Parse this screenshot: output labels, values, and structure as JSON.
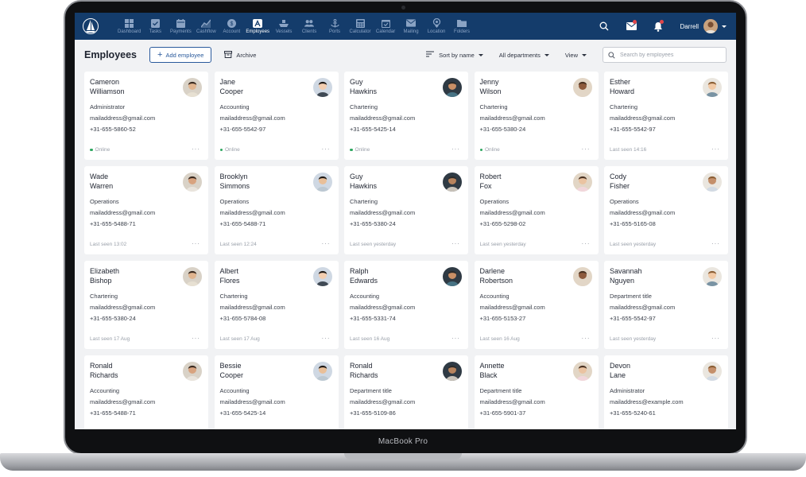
{
  "device_label": "MacBook Pro",
  "nav": {
    "items": [
      {
        "label": "Dashboard",
        "icon": "dashboard-icon"
      },
      {
        "label": "Tasks",
        "icon": "tasks-icon"
      },
      {
        "label": "Payments",
        "icon": "payments-icon"
      },
      {
        "label": "Cashflow",
        "icon": "cashflow-icon"
      },
      {
        "label": "Account",
        "icon": "account-icon"
      },
      {
        "label": "Employees",
        "icon": "employees-icon",
        "active": true
      },
      {
        "label": "Vessels",
        "icon": "vessels-icon"
      },
      {
        "label": "Clients",
        "icon": "clients-icon"
      },
      {
        "label": "Ports",
        "icon": "ports-icon"
      },
      {
        "label": "Calculator",
        "icon": "calculator-icon"
      },
      {
        "label": "Calendar",
        "icon": "calendar-icon"
      },
      {
        "label": "Mailing",
        "icon": "mailing-icon"
      },
      {
        "label": "Location",
        "icon": "location-icon"
      },
      {
        "label": "Folders",
        "icon": "folders-icon"
      }
    ],
    "user_name": "Darrell"
  },
  "toolbar": {
    "title": "Employees",
    "add_label": "Add employee",
    "archive_label": "Archive",
    "sort_label": "Sort by name",
    "departments_label": "All departments",
    "view_label": "View",
    "search_placeholder": "Search by employees"
  },
  "employees": [
    {
      "first": "Cameron",
      "last": "Williamson",
      "dept": "Administrator",
      "email": "mailaddress@gmail.com",
      "phone": "+31-655-5860-52",
      "status": "Online",
      "online": true
    },
    {
      "first": "Jane",
      "last": "Cooper",
      "dept": "Accounting",
      "email": "mailaddress@gmail.com",
      "phone": "+31-655-5542-97",
      "status": "Online",
      "online": true
    },
    {
      "first": "Guy",
      "last": "Hawkins",
      "dept": "Chartering",
      "email": "mailaddress@gmail.com",
      "phone": "+31-655-5425-14",
      "status": "Online",
      "online": true
    },
    {
      "first": "Jenny",
      "last": "Wilson",
      "dept": "Chartering",
      "email": "mailaddress@gmail.com",
      "phone": "+31-655-5380-24",
      "status": "Online",
      "online": true
    },
    {
      "first": "Esther",
      "last": "Howard",
      "dept": "Chartering",
      "email": "mailaddress@gmail.com",
      "phone": "+31-655-5542-97",
      "status": "Last seen 14:16",
      "online": false
    },
    {
      "first": "Wade",
      "last": "Warren",
      "dept": "Operations",
      "email": "mailaddress@gmail.com",
      "phone": "+31-655-5488-71",
      "status": "Last seen 13:02",
      "online": false
    },
    {
      "first": "Brooklyn",
      "last": "Simmons",
      "dept": "Operations",
      "email": "mailaddress@gmail.com",
      "phone": "+31-655-5488-71",
      "status": "Last seen 12:24",
      "online": false
    },
    {
      "first": "Guy",
      "last": "Hawkins",
      "dept": "Chartering",
      "email": "mailaddress@gmail.com",
      "phone": "+31-655-5380-24",
      "status": "Last seen yesterday",
      "online": false
    },
    {
      "first": "Robert",
      "last": "Fox",
      "dept": "Operations",
      "email": "mailaddress@gmail.com",
      "phone": "+31-655-5298-02",
      "status": "Last seen yesterday",
      "online": false
    },
    {
      "first": "Cody",
      "last": "Fisher",
      "dept": "Operations",
      "email": "mailaddress@gmail.com",
      "phone": "+31-655-5165-08",
      "status": "Last seen yesterday",
      "online": false
    },
    {
      "first": "Elizabeth",
      "last": "Bishop",
      "dept": "Chartering",
      "email": "mailaddress@gmail.com",
      "phone": "+31-655-5380-24",
      "status": "Last seen 17 Aug",
      "online": false
    },
    {
      "first": "Albert",
      "last": "Flores",
      "dept": "Chartering",
      "email": "mailaddress@gmail.com",
      "phone": "+31-655-5784-08",
      "status": "Last seen 17 Aug",
      "online": false
    },
    {
      "first": "Ralph",
      "last": "Edwards",
      "dept": "Accounting",
      "email": "mailaddress@gmail.com",
      "phone": "+31-655-5331-74",
      "status": "Last seen 16 Aug",
      "online": false
    },
    {
      "first": "Darlene",
      "last": "Robertson",
      "dept": "Accounting",
      "email": "mailaddress@gmail.com",
      "phone": "+31-655-5153-27",
      "status": "Last seen 16 Aug",
      "online": false
    },
    {
      "first": "Savannah",
      "last": "Nguyen",
      "dept": "Department title",
      "email": "mailaddress@gmail.com",
      "phone": "+31-655-5542-97",
      "status": "Last seen yesterday",
      "online": false
    },
    {
      "first": "Ronald",
      "last": "Richards",
      "dept": "Accounting",
      "email": "mailaddress@gmail.com",
      "phone": "+31-655-5488-71",
      "status": "",
      "online": false
    },
    {
      "first": "Bessie",
      "last": "Cooper",
      "dept": "Accounting",
      "email": "mailaddress@gmail.com",
      "phone": "+31-655-5425-14",
      "status": "",
      "online": false
    },
    {
      "first": "Ronald",
      "last": "Richards",
      "dept": "Department title",
      "email": "mailaddress@gmail.com",
      "phone": "+31-655-5109-86",
      "status": "",
      "online": false
    },
    {
      "first": "Annette",
      "last": "Black",
      "dept": "Department title",
      "email": "mailaddress@gmail.com",
      "phone": "+31-655-5901-37",
      "status": "",
      "online": false
    },
    {
      "first": "Devon",
      "last": "Lane",
      "dept": "Administrator",
      "email": "mailaddress@example.com",
      "phone": "+31-655-5240-61",
      "status": "",
      "online": false
    }
  ],
  "colors": {
    "nav_bg": "#143c6b",
    "accent": "#2a5a9c",
    "online": "#2ea860",
    "notification": "#e2464a"
  }
}
